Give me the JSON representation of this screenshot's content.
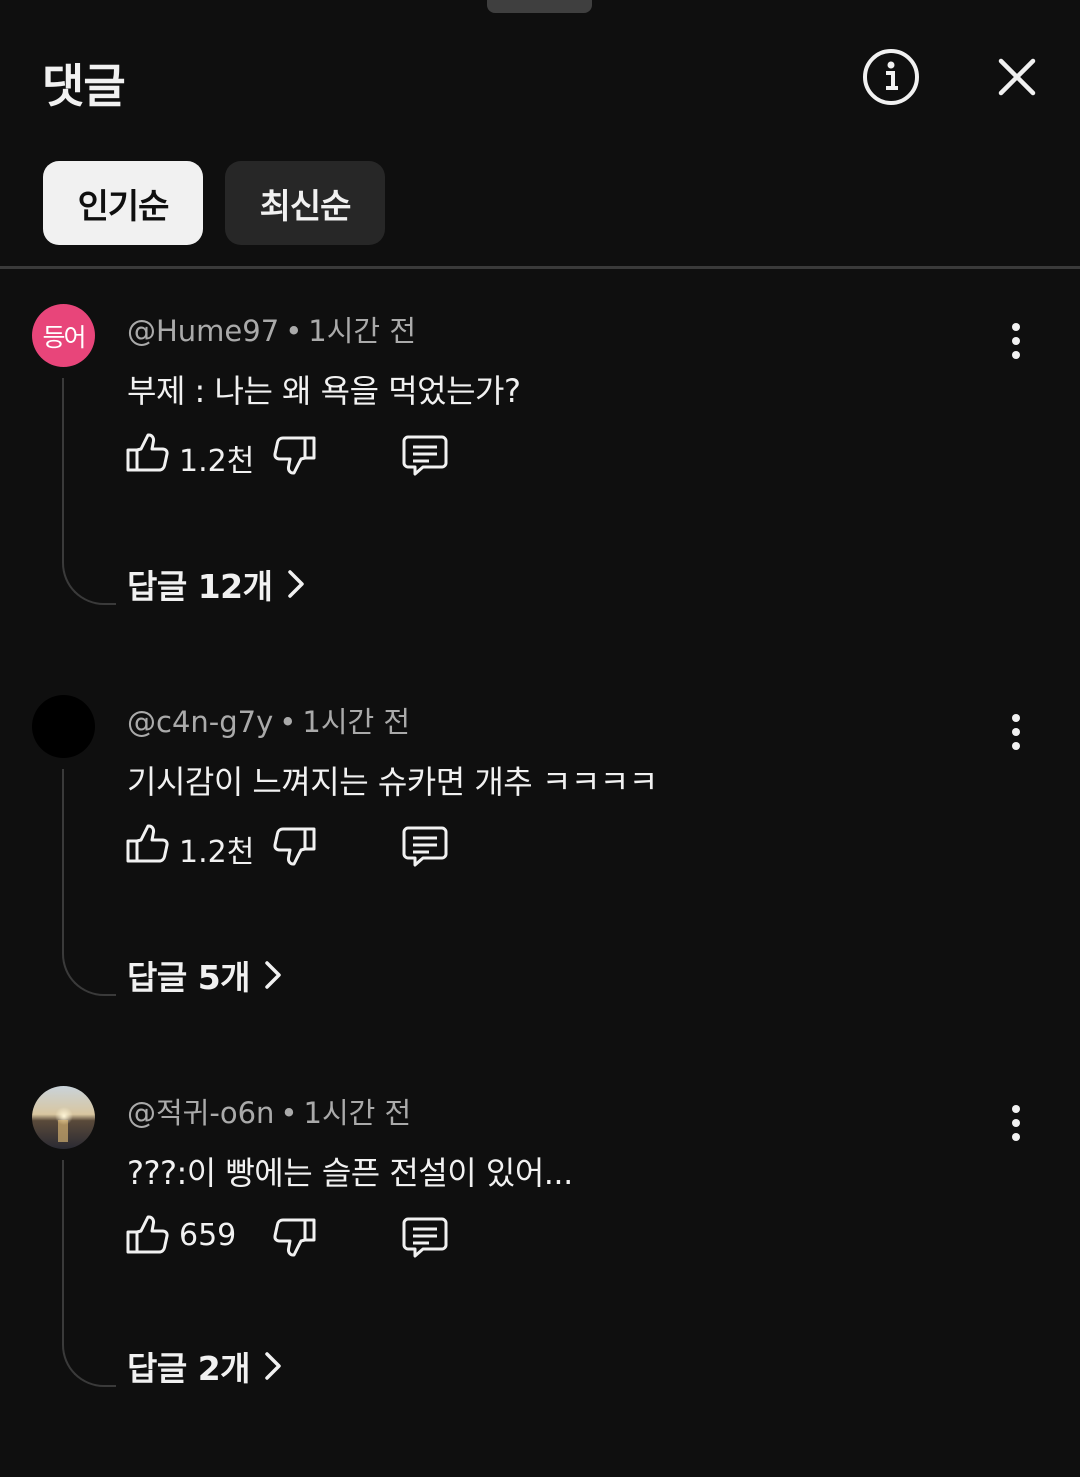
{
  "header": {
    "title": "댓글"
  },
  "icons": {
    "info": "info-circle-icon",
    "close": "close-icon",
    "like": "thumb-up-icon",
    "dislike": "thumb-down-icon",
    "reply": "comment-reply-icon",
    "more": "more-vert-icon",
    "chevron": "chevron-right-icon"
  },
  "sort": {
    "top_label": "인기순",
    "newest_label": "최신순",
    "selected": "인기순"
  },
  "colors": {
    "background": "#0f0f0f",
    "avatar1": "#e8457a",
    "avatar2": "#000000"
  },
  "comments": [
    {
      "avatar_text": "등어",
      "author": "@Hume97",
      "time": "1시간 전",
      "text": "부제 : 나는 왜 욕을 먹었는가?",
      "likes": "1.2천",
      "replies_label": "답글 12개"
    },
    {
      "avatar_text": "",
      "author": "@c4n-g7y",
      "time": "1시간 전",
      "text": "기시감이 느껴지는 슈카면 개추 ㅋㅋㅋㅋ",
      "likes": "1.2천",
      "replies_label": "답글 5개"
    },
    {
      "avatar_text": "",
      "author": "@적귀-o6n",
      "time": "1시간 전",
      "text": "???:이 빵에는 슬픈 전설이 있어...",
      "likes": "659",
      "replies_label": "답글 2개"
    }
  ]
}
